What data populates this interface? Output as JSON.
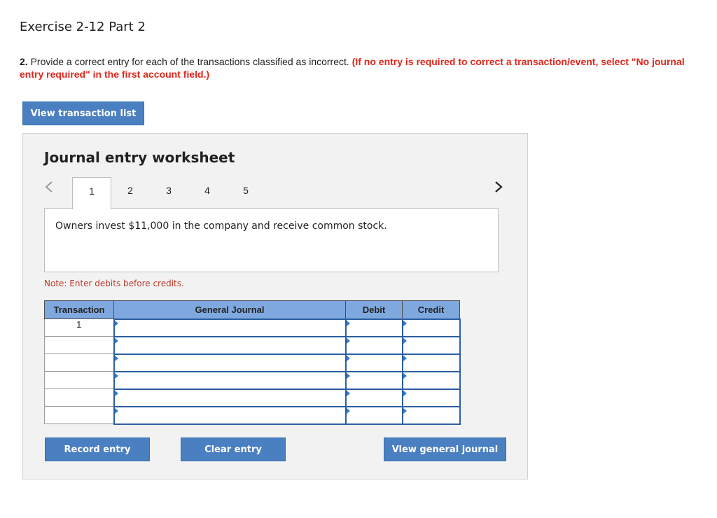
{
  "exercise_title": "Exercise 2-12 Part 2",
  "question": {
    "number": "2.",
    "text": "Provide a correct entry for each of the transactions classified as incorrect.",
    "instruction": "(If no entry is required to correct a transaction/event, select \"No journal entry required\" in the first account field.)"
  },
  "buttons": {
    "view_transaction_list": "View transaction list",
    "record_entry": "Record entry",
    "clear_entry": "Clear entry",
    "view_general_journal": "View general journal"
  },
  "worksheet": {
    "title": "Journal entry worksheet",
    "prev_icon": "chevron-left-icon",
    "next_icon": "chevron-right-icon",
    "tabs": [
      "1",
      "2",
      "3",
      "4",
      "5"
    ],
    "active_tab": "1",
    "description": "Owners invest $11,000 in the company and receive common stock.",
    "note": "Note: Enter debits before credits."
  },
  "journal": {
    "headers": [
      "Transaction",
      "General Journal",
      "Debit",
      "Credit"
    ],
    "rows": [
      {
        "transaction": "1",
        "account": "",
        "debit": "",
        "credit": ""
      },
      {
        "transaction": "",
        "account": "",
        "debit": "",
        "credit": ""
      },
      {
        "transaction": "",
        "account": "",
        "debit": "",
        "credit": ""
      },
      {
        "transaction": "",
        "account": "",
        "debit": "",
        "credit": ""
      },
      {
        "transaction": "",
        "account": "",
        "debit": "",
        "credit": ""
      },
      {
        "transaction": "",
        "account": "",
        "debit": "",
        "credit": ""
      }
    ]
  },
  "colors": {
    "button_blue": "#4a7fc1",
    "header_blue": "#7fa9de",
    "instruction_red": "#e0261b"
  }
}
